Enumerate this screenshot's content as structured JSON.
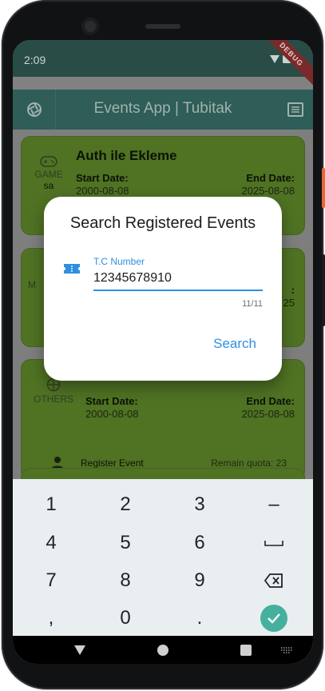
{
  "status_bar": {
    "time": "2:09",
    "debug_label": "DEBUG"
  },
  "app_bar": {
    "title": "Events App | Tubitak"
  },
  "event_cards": [
    {
      "category": "GAME",
      "category_value": "sa",
      "title": "Auth ile Ekleme",
      "start_label": "Start Date:",
      "start_date": "2000-08-08",
      "end_label": "End Date:",
      "end_date": "2025-08-08"
    },
    {
      "category_partial": "M",
      "end_partial_label": ":",
      "end_partial_value": "25"
    },
    {
      "category": "OTHERS",
      "start_label": "Start Date:",
      "start_date": "2000-08-08",
      "end_label": "End Date:",
      "end_date": "2025-08-08",
      "register_label": "Register Event",
      "quota_label": "Remain quota: 23"
    }
  ],
  "dialog": {
    "title": "Search Registered Events",
    "field_label": "T.C Number",
    "field_value": "12345678910",
    "counter": "11/11",
    "action_label": "Search"
  },
  "keyboard": {
    "keys": [
      "1",
      "2",
      "3",
      "–",
      "4",
      "5",
      "6",
      "␣",
      "7",
      "8",
      "9",
      "⌫",
      ",",
      "0",
      "."
    ]
  },
  "colors": {
    "accent": "#2f8fe0",
    "card_green": "#4f7223",
    "app_bar": "#2f5d57",
    "done_key": "#45b09e"
  }
}
